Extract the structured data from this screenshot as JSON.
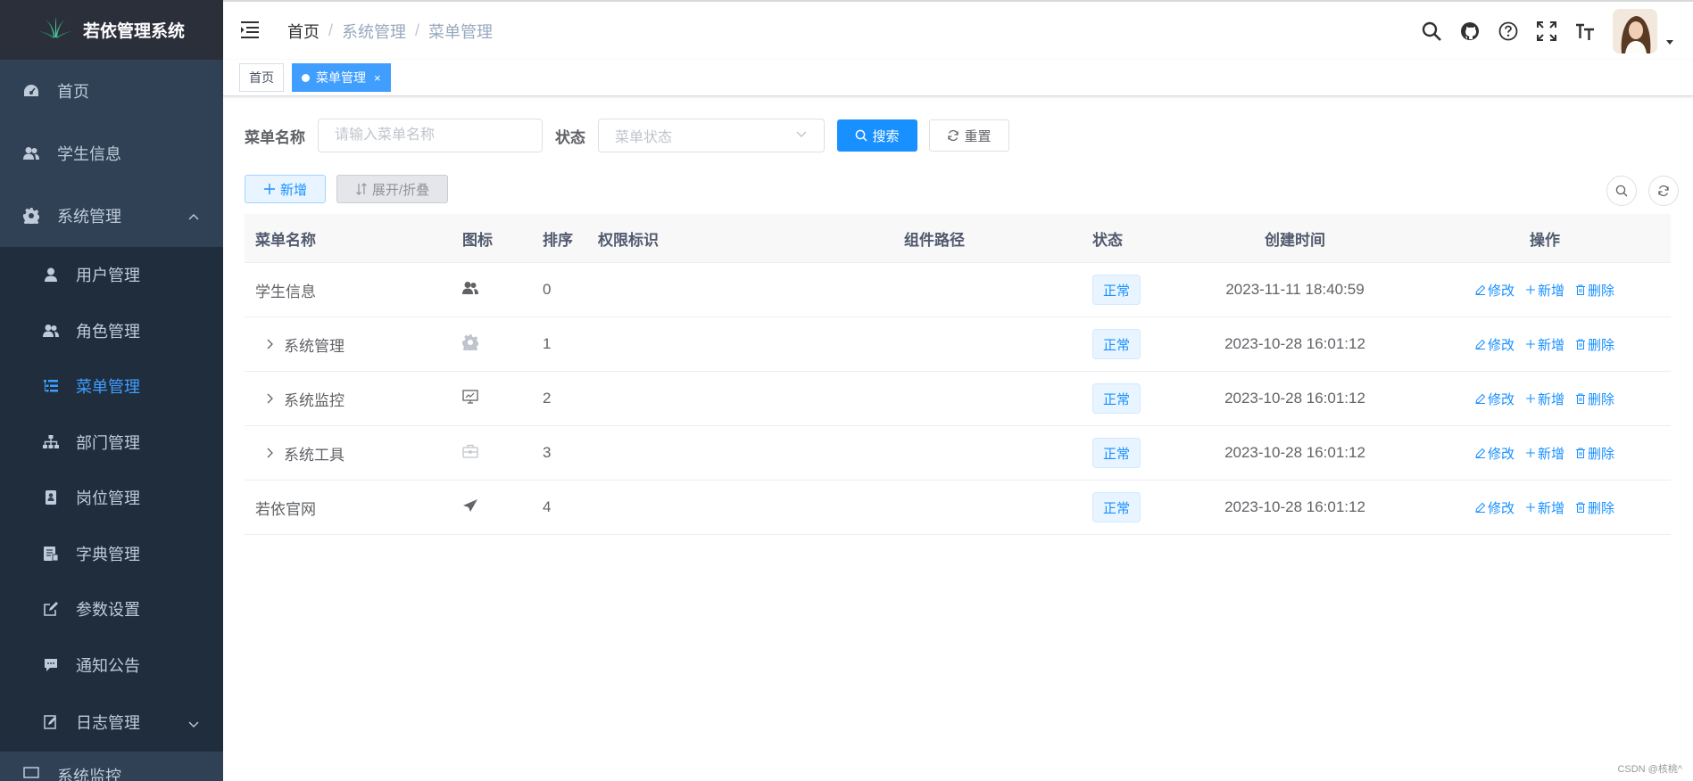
{
  "sidebar": {
    "logo_title": "若依管理系统",
    "menu": [
      {
        "label": "首页",
        "icon": "dashboard-icon"
      },
      {
        "label": "学生信息",
        "icon": "peoples-icon"
      },
      {
        "label": "系统管理",
        "icon": "system-gear-icon",
        "expanded": true
      }
    ],
    "submenu": [
      {
        "label": "用户管理",
        "icon": "user-icon"
      },
      {
        "label": "角色管理",
        "icon": "peoples-icon"
      },
      {
        "label": "菜单管理",
        "icon": "tree-table-icon",
        "active": true
      },
      {
        "label": "部门管理",
        "icon": "tree-icon"
      },
      {
        "label": "岗位管理",
        "icon": "post-icon"
      },
      {
        "label": "字典管理",
        "icon": "dict-icon"
      },
      {
        "label": "参数设置",
        "icon": "edit-icon"
      },
      {
        "label": "通知公告",
        "icon": "message-icon"
      },
      {
        "label": "日志管理",
        "icon": "log-icon"
      }
    ],
    "partial_label": "系统监控",
    "active_color": "#409eff",
    "bg_color": "#304156"
  },
  "navbar": {
    "breadcrumb": [
      "首页",
      "系统管理",
      "菜单管理"
    ],
    "separator": "/"
  },
  "tags": {
    "home": "首页",
    "current": "菜单管理",
    "close": "×"
  },
  "search": {
    "name_label": "菜单名称",
    "name_placeholder": "请输入菜单名称",
    "status_label": "状态",
    "status_placeholder": "菜单状态",
    "search_button": "搜索",
    "reset_button": "重置"
  },
  "toolbar": {
    "add_button": "新增",
    "expand_button": "展开/折叠"
  },
  "table": {
    "columns": [
      "菜单名称",
      "图标",
      "排序",
      "权限标识",
      "组件路径",
      "状态",
      "创建时间",
      "操作"
    ],
    "rows": [
      {
        "name": "学生信息",
        "icon": "peoples-icon",
        "order": "0",
        "perm": "",
        "component": "",
        "status": "正常",
        "created": "2023-11-11 18:40:59",
        "expandable": false
      },
      {
        "name": "系统管理",
        "icon": "system-gear-icon",
        "order": "1",
        "perm": "",
        "component": "",
        "status": "正常",
        "created": "2023-10-28 16:01:12",
        "expandable": true
      },
      {
        "name": "系统监控",
        "icon": "monitor-icon",
        "order": "2",
        "perm": "",
        "component": "",
        "status": "正常",
        "created": "2023-10-28 16:01:12",
        "expandable": true
      },
      {
        "name": "系统工具",
        "icon": "tool-icon",
        "order": "3",
        "perm": "",
        "component": "",
        "status": "正常",
        "created": "2023-10-28 16:01:12",
        "expandable": true
      },
      {
        "name": "若依官网",
        "icon": "guide-icon",
        "order": "4",
        "perm": "",
        "component": "",
        "status": "正常",
        "created": "2023-10-28 16:01:12",
        "expandable": false
      }
    ],
    "ops": {
      "edit": "修改",
      "add": "新增",
      "delete": "删除"
    }
  },
  "watermark": "CSDN @核桃^"
}
